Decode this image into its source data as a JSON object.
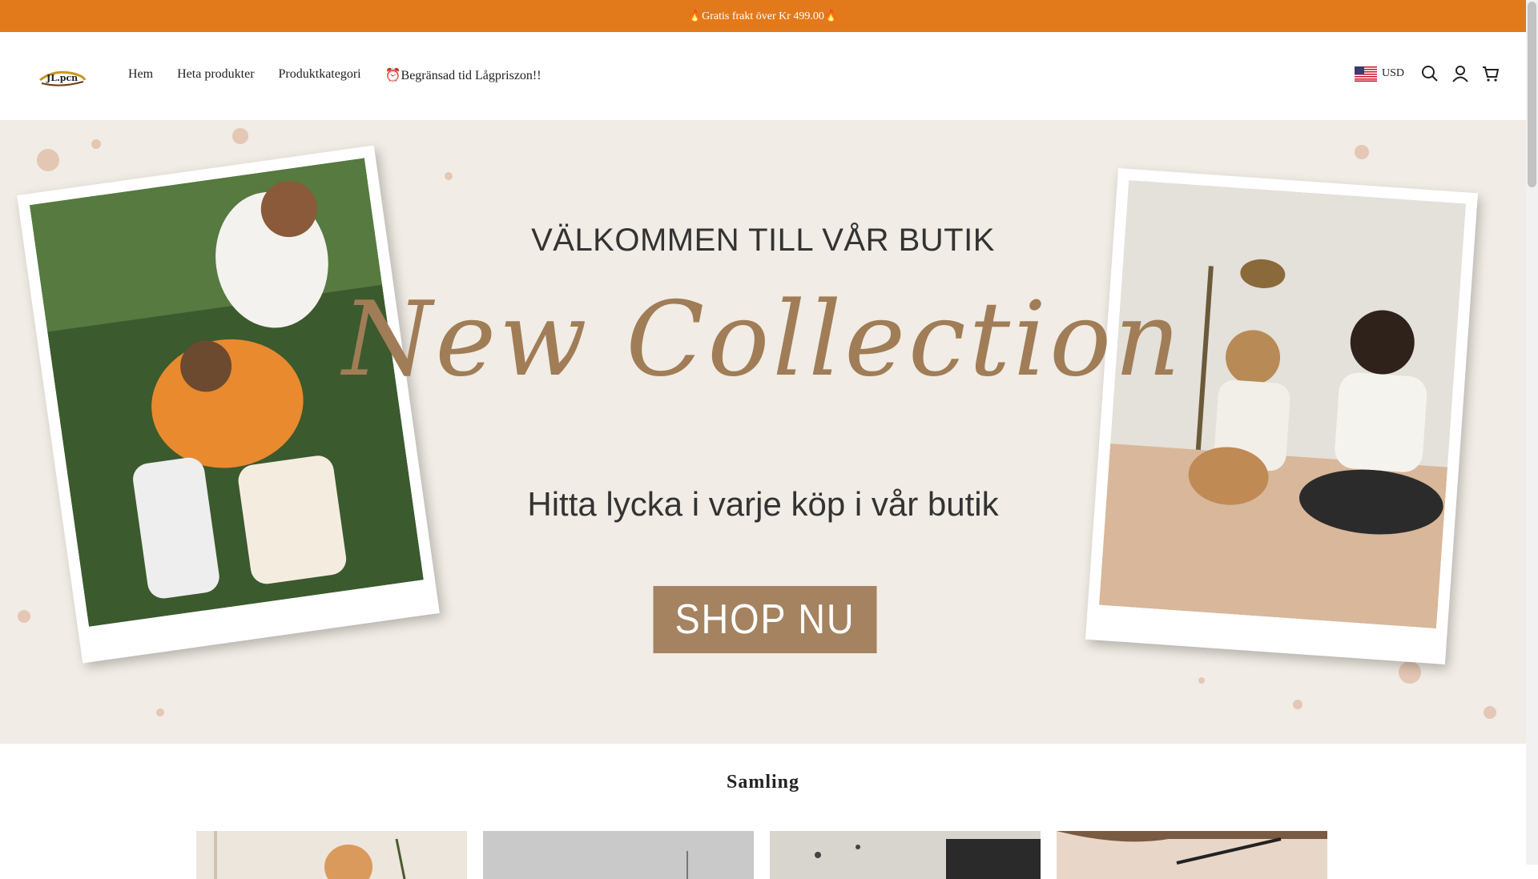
{
  "announcement": {
    "text": "🔥Gratis frakt över Kr 499.00🔥"
  },
  "header": {
    "logo_text": "JL.pcn",
    "nav": [
      {
        "label": "Hem"
      },
      {
        "label": "Heta produkter"
      },
      {
        "label": "Produktkategori"
      },
      {
        "label": "⏰Begränsad tid Lågpriszon!!"
      }
    ],
    "currency": "USD",
    "icons": [
      "search-icon",
      "account-icon",
      "cart-icon"
    ]
  },
  "hero": {
    "welcome": "VÄLKOMMEN TILL VÅR BUTIK",
    "script_title": "New Collection",
    "tagline": "Hitta lycka i varje köp i vår butik",
    "cta_label": "SHOP  NU"
  },
  "collections": {
    "heading": "Samling",
    "items": [
      {
        "name": "collection-1"
      },
      {
        "name": "collection-2"
      },
      {
        "name": "collection-3"
      },
      {
        "name": "collection-4"
      }
    ]
  },
  "colors": {
    "announcement_bg": "#e2791b",
    "hero_bg": "#f1ece5",
    "accent": "#a58360"
  }
}
